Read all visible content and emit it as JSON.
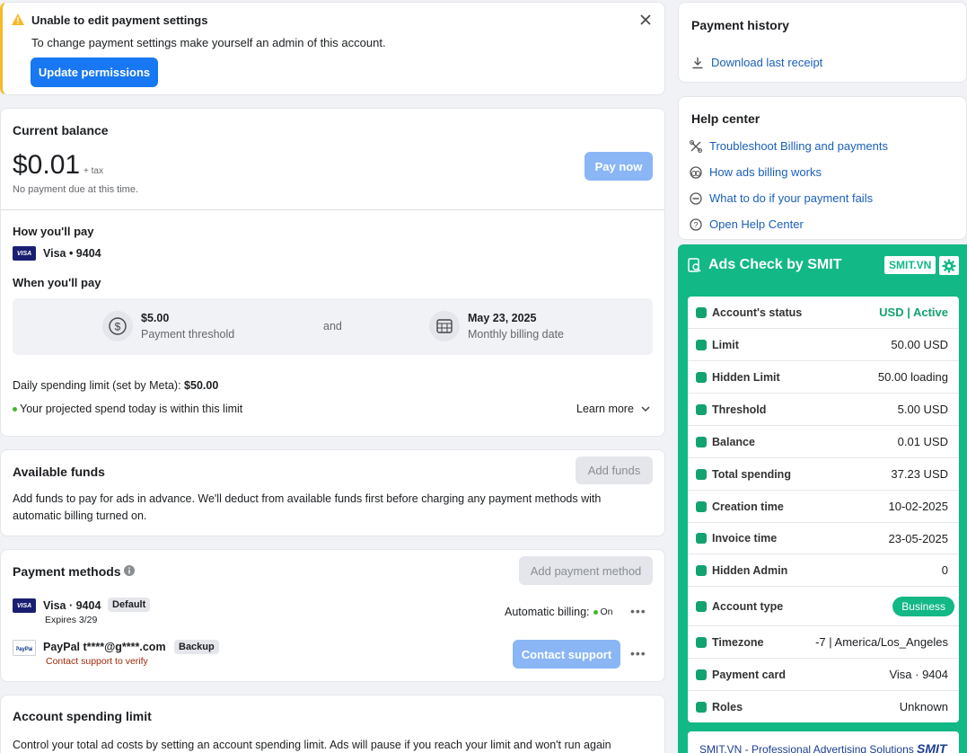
{
  "warning": {
    "title": "Unable to edit payment settings",
    "message": "To change payment settings make yourself an admin of this account.",
    "button": "Update permissions"
  },
  "balance": {
    "heading": "Current balance",
    "amount": "$0.01",
    "tax": "+ tax",
    "due": "No payment due at this time.",
    "pay_now": "Pay now",
    "how_heading": "How you'll pay",
    "card": "Visa • 9404",
    "when_heading": "When you'll pay",
    "threshold_value": "$5.00",
    "threshold_label": "Payment threshold",
    "and": "and",
    "date_value": "May 23, 2025",
    "date_label": "Monthly billing date",
    "daily_limit_prefix": "Daily spending limit (set by Meta): ",
    "daily_limit_value": "$50.00",
    "projected": "Your projected spend today is within this limit",
    "learn_more": "Learn more"
  },
  "funds": {
    "heading": "Available funds",
    "button": "Add funds",
    "desc": "Add funds to pay for ads in advance. We'll deduct from available funds first before charging any payment methods with automatic billing turned on."
  },
  "methods": {
    "heading": "Payment methods",
    "add_button": "Add payment method",
    "visa_name": "Visa · 9404",
    "visa_badge": "Default",
    "visa_expires": "Expires 3/29",
    "auto_billing": "Automatic billing:",
    "auto_on": "On",
    "paypal_name": "PayPal t****@g****.com",
    "paypal_badge": "Backup",
    "paypal_note": "Contact support to verify",
    "contact_support": "Contact support"
  },
  "spending_limit": {
    "heading": "Account spending limit",
    "desc": "Control your total ad costs by setting an account spending limit. Ads will pause if you reach your limit and won't run again"
  },
  "history": {
    "heading": "Payment history",
    "download": "Download last receipt"
  },
  "help": {
    "heading": "Help center",
    "items": [
      {
        "label": "Troubleshoot Billing and payments",
        "icon": "tools-icon"
      },
      {
        "label": "How ads billing works",
        "icon": "billing-icon"
      },
      {
        "label": "What to do if your payment fails",
        "icon": "minus-circle-icon"
      },
      {
        "label": "Open Help Center",
        "icon": "question-icon"
      }
    ]
  },
  "smit": {
    "title": "Ads Check by SMIT",
    "badge": "SMIT.VN",
    "rows": [
      {
        "label": "Account's status",
        "value": "USD | Active"
      },
      {
        "label": "Limit",
        "value": "50.00 USD"
      },
      {
        "label": "Hidden Limit",
        "value": "50.00 loading"
      },
      {
        "label": "Threshold",
        "value": "5.00 USD"
      },
      {
        "label": "Balance",
        "value": "0.01 USD"
      },
      {
        "label": "Total spending",
        "value": "37.23 USD"
      },
      {
        "label": "Creation time",
        "value": "10-02-2025"
      },
      {
        "label": "Invoice time",
        "value": "23-05-2025"
      },
      {
        "label": "Hidden Admin",
        "value": "0"
      },
      {
        "label": "Account type",
        "value": "Business"
      },
      {
        "label": "Timezone",
        "value": "-7 | America/Los_Angeles"
      },
      {
        "label": "Payment card",
        "value": "Visa · 9404"
      },
      {
        "label": "Roles",
        "value": "Unknown"
      }
    ],
    "footer": "SMIT.VN - Professional Advertising Solutions",
    "footer_logo": "SMIT"
  },
  "colors": {
    "accent": "#1877f2",
    "smit_green": "#12b886",
    "warning": "#f7b928"
  }
}
